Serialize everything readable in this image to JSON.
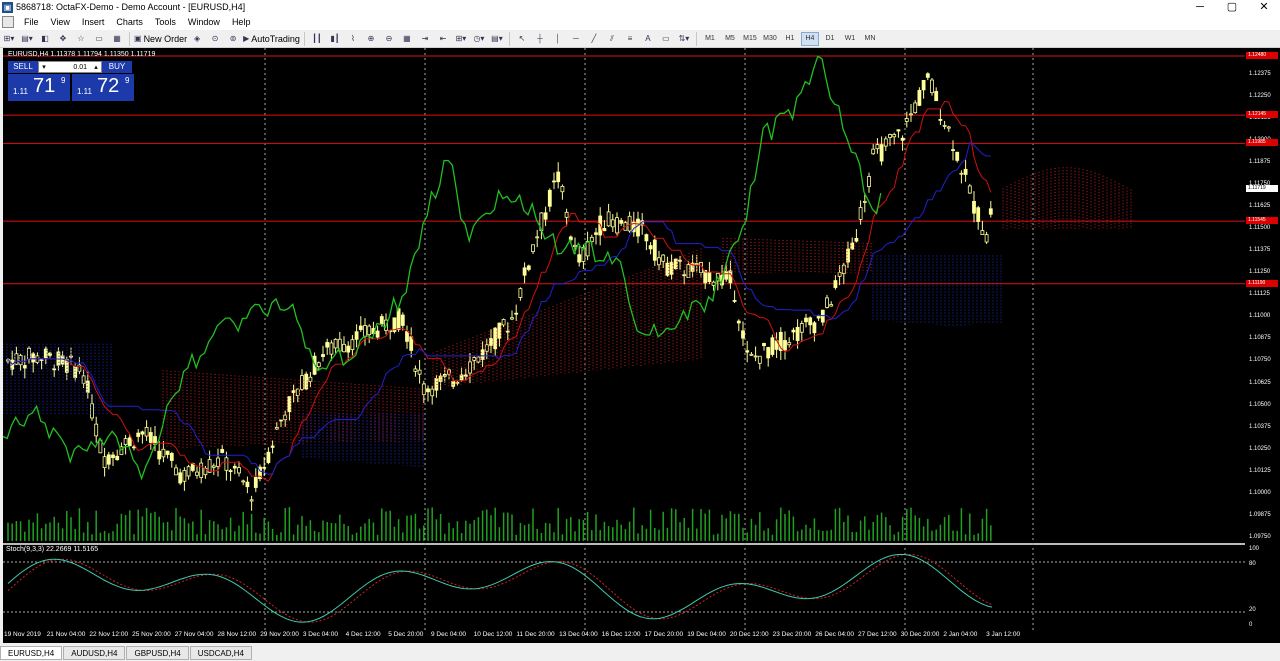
{
  "window": {
    "title": "5868718: OctaFX-Demo - Demo Account - [EURUSD,H4]",
    "icon": "app-icon",
    "controls": [
      "─",
      "▢",
      "✕"
    ]
  },
  "menu": {
    "items": [
      "File",
      "View",
      "Insert",
      "Charts",
      "Tools",
      "Window",
      "Help"
    ]
  },
  "toolbar": {
    "new_order_label": "New Order",
    "autotrading_label": "AutoTrading",
    "timeframes": [
      "M1",
      "M5",
      "M15",
      "M30",
      "H1",
      "H4",
      "D1",
      "W1",
      "MN"
    ],
    "active_timeframe": "H4"
  },
  "chart": {
    "symbol_label": "EURUSD,H4  1.11378 1.11794 1.11350 1.11719",
    "trade_panel": {
      "sell_label": "SELL",
      "buy_label": "BUY",
      "lot_value": "0.01",
      "sell_small": "1.11",
      "sell_big": "71",
      "sell_sup": "9",
      "buy_small": "1.11",
      "buy_big": "72",
      "buy_sup": "9"
    },
    "price_axis": [
      "1.12375",
      "1.12250",
      "1.12125",
      "1.12000",
      "1.11875",
      "1.11750",
      "1.11625",
      "1.11500",
      "1.11375",
      "1.11250",
      "1.11125",
      "1.11000",
      "1.10875",
      "1.10750",
      "1.10625",
      "1.10500",
      "1.10375",
      "1.10250",
      "1.10125",
      "1.10000",
      "1.09875",
      "1.09750"
    ],
    "level_tags": [
      "1.12480",
      "1.12145",
      "1.11985",
      "1.11545",
      "1.11190"
    ],
    "current_price_tag": "1.11719",
    "stoch_label": "Stoch(9,3,3) 22.2669 11.5165",
    "stoch_axis": [
      "100",
      "80",
      "20",
      "0"
    ],
    "time_axis": [
      "19 Nov 2019",
      "21 Nov 04:00",
      "22 Nov 12:00",
      "25 Nov 20:00",
      "27 Nov 04:00",
      "28 Nov 12:00",
      "29 Nov 20:00",
      "3 Dec 04:00",
      "4 Dec 12:00",
      "5 Dec 20:00",
      "9 Dec 04:00",
      "10 Dec 12:00",
      "11 Dec 20:00",
      "13 Dec 04:00",
      "16 Dec 12:00",
      "17 Dec 20:00",
      "19 Dec 04:00",
      "20 Dec 12:00",
      "23 Dec 20:00",
      "26 Dec 04:00",
      "27 Dec 12:00",
      "30 Dec 20:00",
      "2 Jan 04:00",
      "3 Jan 12:00"
    ],
    "colors": {
      "background": "#000000",
      "candle": "#ffff9a",
      "tenkan": "#d01010",
      "kijun": "#2020d0",
      "chikou": "#20c020",
      "kumo_bear": "#c02020",
      "kumo_bull": "#2030c0",
      "volume": "#20a020",
      "level_line": "#e01010"
    }
  },
  "tabs": [
    "EURUSD,H4",
    "AUDUSD,H4",
    "GBPUSD,H4",
    "USDCAD,H4"
  ],
  "active_tab": "EURUSD,H4"
}
